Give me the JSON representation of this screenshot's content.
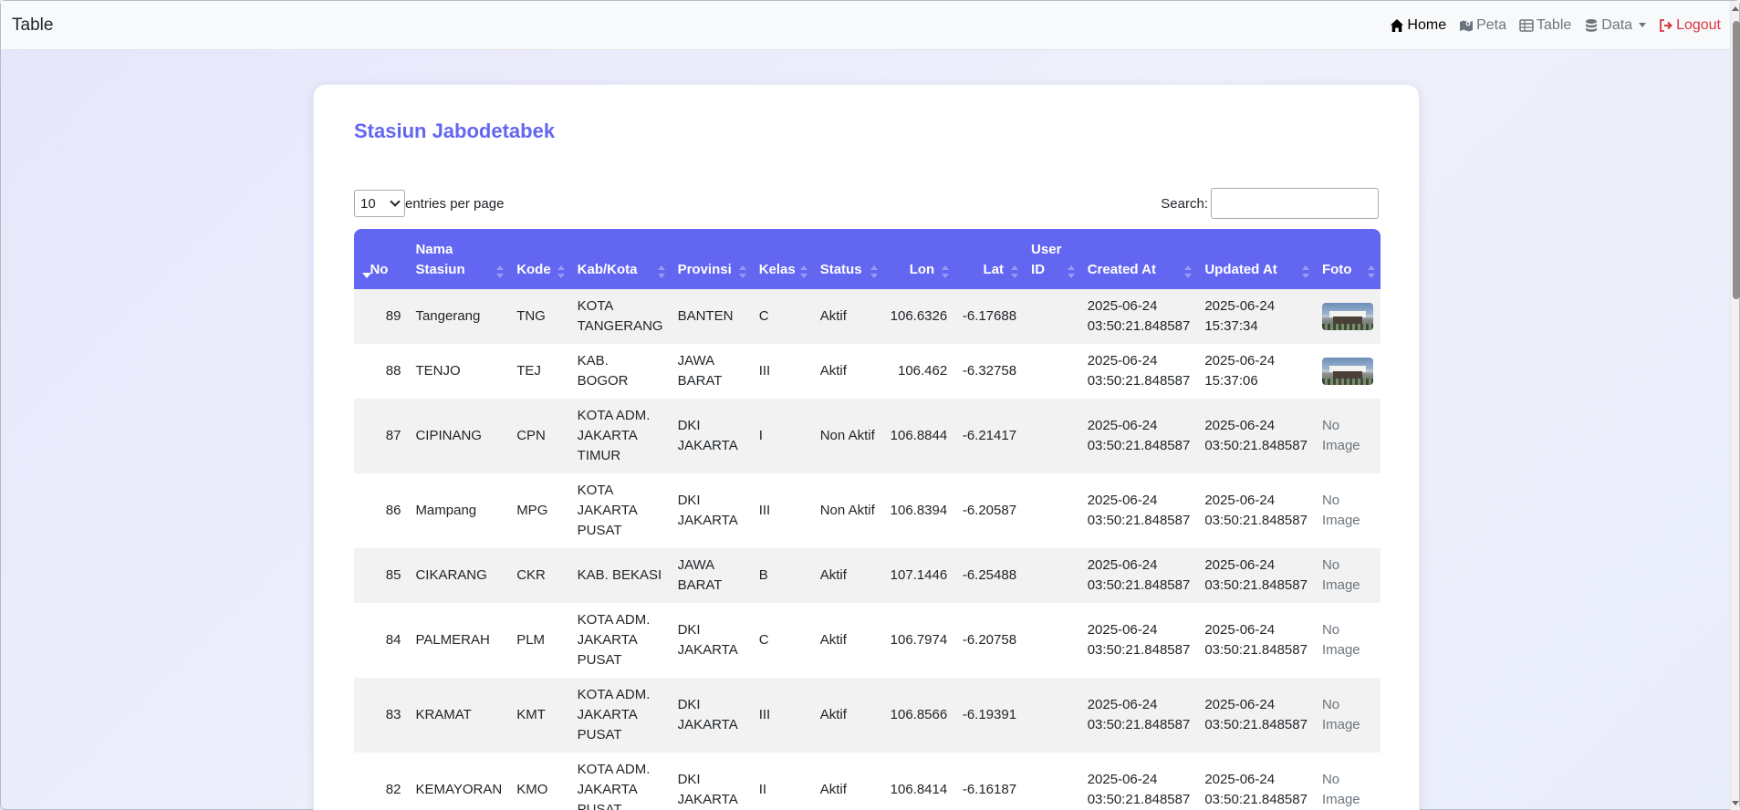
{
  "navbar": {
    "brand": "Table",
    "links": {
      "home": "Home",
      "peta": "Peta",
      "table": "Table",
      "data": "Data",
      "logout": "Logout"
    }
  },
  "card": {
    "title": "Stasiun Jabodetabek",
    "entries_value": "10",
    "entries_label": "entries per page",
    "search_label": "Search:",
    "search_value": ""
  },
  "table": {
    "columns": [
      "No",
      "Nama Stasiun",
      "Kode",
      "Kab/Kota",
      "Provinsi",
      "Kelas",
      "Status",
      "Lon",
      "Lat",
      "User ID",
      "Created At",
      "Updated At",
      "Foto"
    ],
    "rows": [
      {
        "no": "89",
        "nama": "Tangerang",
        "kode": "TNG",
        "kab": "KOTA TANGERANG",
        "prov": "BANTEN",
        "kelas": "C",
        "status": "Aktif",
        "lon": "106.6326",
        "lat": "-6.17688",
        "user": "",
        "created": "2025-06-24 03:50:21.848587",
        "updated": "2025-06-24 15:37:34",
        "foto": "image"
      },
      {
        "no": "88",
        "nama": "TENJO",
        "kode": "TEJ",
        "kab": "KAB. BOGOR",
        "prov": "JAWA BARAT",
        "kelas": "III",
        "status": "Aktif",
        "lon": "106.462",
        "lat": "-6.32758",
        "user": "",
        "created": "2025-06-24 03:50:21.848587",
        "updated": "2025-06-24 15:37:06",
        "foto": "image"
      },
      {
        "no": "87",
        "nama": "CIPINANG",
        "kode": "CPN",
        "kab": "KOTA ADM. JAKARTA TIMUR",
        "prov": "DKI JAKARTA",
        "kelas": "I",
        "status": "Non Aktif",
        "lon": "106.8844",
        "lat": "-6.21417",
        "user": "",
        "created": "2025-06-24 03:50:21.848587",
        "updated": "2025-06-24 03:50:21.848587",
        "foto": "No Image"
      },
      {
        "no": "86",
        "nama": "Mampang",
        "kode": "MPG",
        "kab": "KOTA JAKARTA PUSAT",
        "prov": "DKI JAKARTA",
        "kelas": "III",
        "status": "Non Aktif",
        "lon": "106.8394",
        "lat": "-6.20587",
        "user": "",
        "created": "2025-06-24 03:50:21.848587",
        "updated": "2025-06-24 03:50:21.848587",
        "foto": "No Image"
      },
      {
        "no": "85",
        "nama": "CIKARANG",
        "kode": "CKR",
        "kab": "KAB. BEKASI",
        "prov": "JAWA BARAT",
        "kelas": "B",
        "status": "Aktif",
        "lon": "107.1446",
        "lat": "-6.25488",
        "user": "",
        "created": "2025-06-24 03:50:21.848587",
        "updated": "2025-06-24 03:50:21.848587",
        "foto": "No Image"
      },
      {
        "no": "84",
        "nama": "PALMERAH",
        "kode": "PLM",
        "kab": "KOTA ADM. JAKARTA PUSAT",
        "prov": "DKI JAKARTA",
        "kelas": "C",
        "status": "Aktif",
        "lon": "106.7974",
        "lat": "-6.20758",
        "user": "",
        "created": "2025-06-24 03:50:21.848587",
        "updated": "2025-06-24 03:50:21.848587",
        "foto": "No Image"
      },
      {
        "no": "83",
        "nama": "KRAMAT",
        "kode": "KMT",
        "kab": "KOTA ADM. JAKARTA PUSAT",
        "prov": "DKI JAKARTA",
        "kelas": "III",
        "status": "Aktif",
        "lon": "106.8566",
        "lat": "-6.19391",
        "user": "",
        "created": "2025-06-24 03:50:21.848587",
        "updated": "2025-06-24 03:50:21.848587",
        "foto": "No Image"
      },
      {
        "no": "82",
        "nama": "KEMAYORAN",
        "kode": "KMO",
        "kab": "KOTA ADM. JAKARTA PUSAT",
        "prov": "DKI JAKARTA",
        "kelas": "II",
        "status": "Aktif",
        "lon": "106.8414",
        "lat": "-6.16187",
        "user": "",
        "created": "2025-06-24 03:50:21.848587",
        "updated": "2025-06-24 03:50:21.848587",
        "foto": "No Image"
      }
    ]
  },
  "colors": {
    "accent": "#6366f1",
    "logout": "#dc3545",
    "row_stripe": "#f2f2f2"
  }
}
